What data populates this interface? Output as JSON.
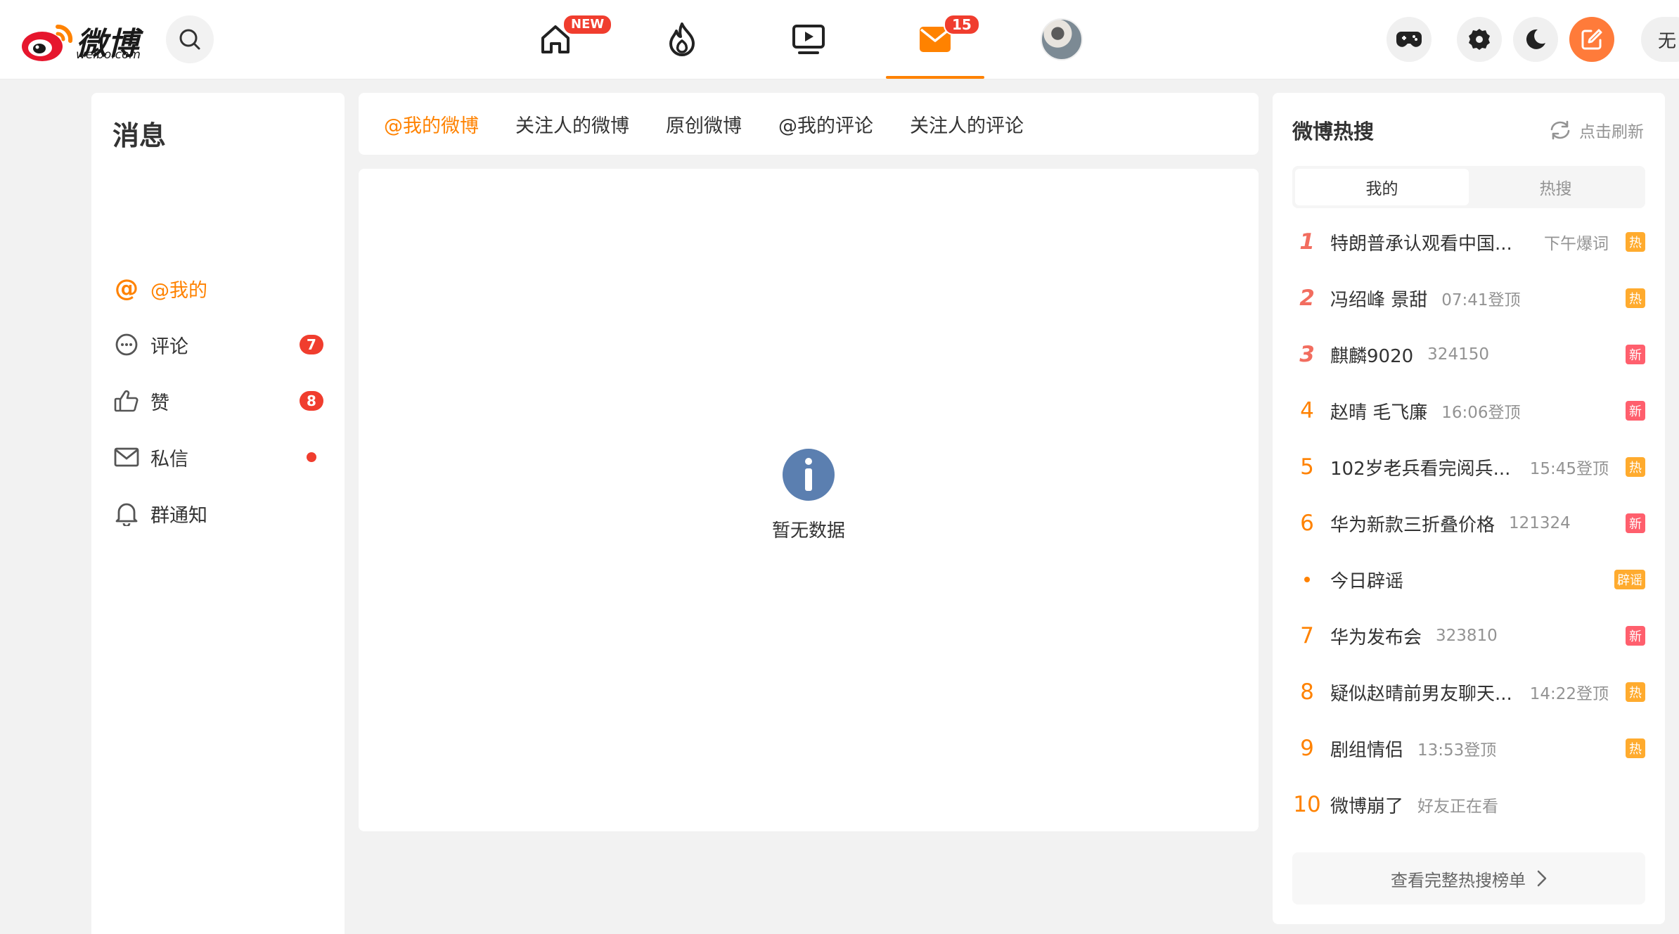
{
  "header": {
    "logo_text": "微博",
    "logo_sub": "weibo.com",
    "nav": [
      {
        "name": "home",
        "badge": "NEW"
      },
      {
        "name": "hot",
        "badge": ""
      },
      {
        "name": "video",
        "badge": ""
      },
      {
        "name": "messages",
        "badge": "15",
        "active": true
      },
      {
        "name": "profile",
        "badge": ""
      }
    ],
    "partial_button_label": "无"
  },
  "sidebar": {
    "title": "消息",
    "items": [
      {
        "label": "@我的",
        "badge": "",
        "active": true
      },
      {
        "label": "评论",
        "badge": "7"
      },
      {
        "label": "赞",
        "badge": "8"
      },
      {
        "label": "私信",
        "badge": "dot"
      },
      {
        "label": "群通知",
        "badge": ""
      }
    ]
  },
  "tabs": [
    "@我的微博",
    "关注人的微博",
    "原创微博",
    "@我的评论",
    "关注人的评论"
  ],
  "main": {
    "empty_text": "暂无数据"
  },
  "hot": {
    "title": "微博热搜",
    "refresh_label": "点击刷新",
    "segments": [
      "我的",
      "热搜"
    ],
    "rows": [
      {
        "rank": "1",
        "word": "特朗普承认观看中国...",
        "meta": "下午爆词",
        "meta_right": true,
        "tag": "热",
        "tag_type": "hot"
      },
      {
        "rank": "2",
        "word": "冯绍峰 景甜",
        "meta": "07:41登顶",
        "tag": "热",
        "tag_type": "hot"
      },
      {
        "rank": "3",
        "word": "麒麟9020",
        "meta": "324150",
        "tag": "新",
        "tag_type": "new"
      },
      {
        "rank": "4",
        "word": "赵晴 毛飞廉",
        "meta": "16:06登顶",
        "tag": "新",
        "tag_type": "new"
      },
      {
        "rank": "5",
        "word": "102岁老兵看完阅兵...",
        "meta": "15:45登顶",
        "meta_right": true,
        "tag": "热",
        "tag_type": "hot"
      },
      {
        "rank": "6",
        "word": "华为新款三折叠价格",
        "meta": "121324",
        "tag": "新",
        "tag_type": "new"
      },
      {
        "rank": "•",
        "word": "今日辟谣",
        "meta": "",
        "tag": "辟谣",
        "tag_type": "rumor"
      },
      {
        "rank": "7",
        "word": "华为发布会",
        "meta": "323810",
        "tag": "新",
        "tag_type": "new"
      },
      {
        "rank": "8",
        "word": "疑似赵晴前男友聊天...",
        "meta": "14:22登顶",
        "meta_right": true,
        "tag": "热",
        "tag_type": "hot"
      },
      {
        "rank": "9",
        "word": "剧组情侣",
        "meta": "13:53登顶",
        "tag": "热",
        "tag_type": "hot"
      },
      {
        "rank": "10",
        "word": "微博崩了",
        "meta": "好友正在看",
        "tag": "",
        "tag_type": ""
      }
    ],
    "full_list_label": "查看完整热搜榜单"
  },
  "colors": {
    "accent": "#ff8200",
    "badge_red": "#f03d2e",
    "tag_hot": "#ffab2e",
    "tag_new": "#ff5f6d",
    "info_blue": "#5b7fb0"
  }
}
